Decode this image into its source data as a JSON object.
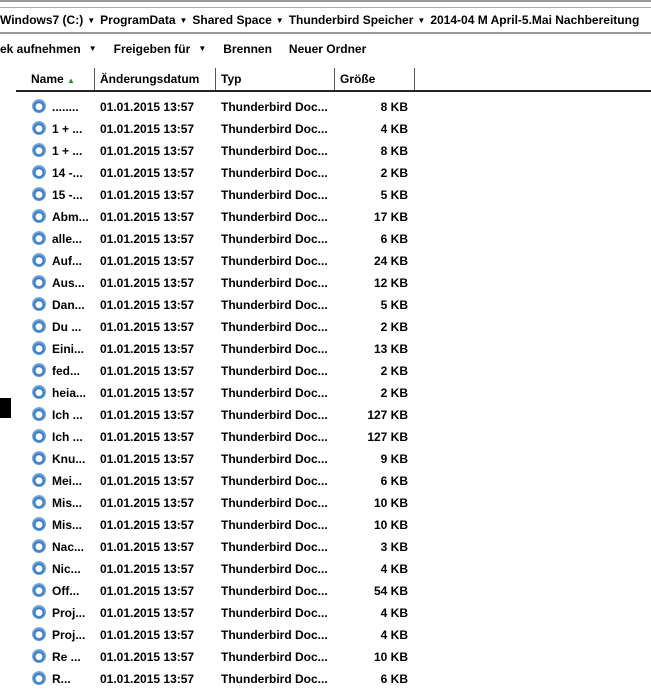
{
  "breadcrumb": [
    "Windows7 (C:)",
    "ProgramData",
    "Shared Space",
    "Thunderbird Speicher",
    "2014-04 M April-5.Mai Nachbereitung"
  ],
  "toolbar": [
    {
      "label": "ek aufnehmen",
      "dropdown": true
    },
    {
      "label": "Freigeben für",
      "dropdown": true
    },
    {
      "label": "Brennen",
      "dropdown": false
    },
    {
      "label": "Neuer Ordner",
      "dropdown": false
    }
  ],
  "columns": {
    "name": "Name",
    "sort_icon": "▲",
    "date": "Änderungsdatum",
    "type": "Typ",
    "size": "Größe"
  },
  "files": [
    {
      "name": "........",
      "date": "01.01.2015 13:57",
      "type": "Thunderbird Doc...",
      "size": "8 KB"
    },
    {
      "name": "1 + ...",
      "date": "01.01.2015 13:57",
      "type": "Thunderbird Doc...",
      "size": "4 KB"
    },
    {
      "name": "1 + ...",
      "date": "01.01.2015 13:57",
      "type": "Thunderbird Doc...",
      "size": "8 KB"
    },
    {
      "name": "14 -...",
      "date": "01.01.2015 13:57",
      "type": "Thunderbird Doc...",
      "size": "2 KB"
    },
    {
      "name": "15 -...",
      "date": "01.01.2015 13:57",
      "type": "Thunderbird Doc...",
      "size": "5 KB"
    },
    {
      "name": "Abm...",
      "date": "01.01.2015 13:57",
      "type": "Thunderbird Doc...",
      "size": "17 KB"
    },
    {
      "name": "alle...",
      "date": "01.01.2015 13:57",
      "type": "Thunderbird Doc...",
      "size": "6 KB"
    },
    {
      "name": "Auf...",
      "date": "01.01.2015 13:57",
      "type": "Thunderbird Doc...",
      "size": "24 KB"
    },
    {
      "name": "Aus...",
      "date": "01.01.2015 13:57",
      "type": "Thunderbird Doc...",
      "size": "12 KB"
    },
    {
      "name": "Dan...",
      "date": "01.01.2015 13:57",
      "type": "Thunderbird Doc...",
      "size": "5 KB"
    },
    {
      "name": "Du ...",
      "date": "01.01.2015 13:57",
      "type": "Thunderbird Doc...",
      "size": "2 KB"
    },
    {
      "name": "Eini...",
      "date": "01.01.2015 13:57",
      "type": "Thunderbird Doc...",
      "size": "13 KB"
    },
    {
      "name": "fed...",
      "date": "01.01.2015 13:57",
      "type": "Thunderbird Doc...",
      "size": "2 KB"
    },
    {
      "name": "heia...",
      "date": "01.01.2015 13:57",
      "type": "Thunderbird Doc...",
      "size": "2 KB"
    },
    {
      "name": "Ich ...",
      "date": "01.01.2015 13:57",
      "type": "Thunderbird Doc...",
      "size": "127 KB"
    },
    {
      "name": "Ich ...",
      "date": "01.01.2015 13:57",
      "type": "Thunderbird Doc...",
      "size": "127 KB"
    },
    {
      "name": "Knu...",
      "date": "01.01.2015 13:57",
      "type": "Thunderbird Doc...",
      "size": "9 KB"
    },
    {
      "name": "Mei...",
      "date": "01.01.2015 13:57",
      "type": "Thunderbird Doc...",
      "size": "6 KB"
    },
    {
      "name": "Mis...",
      "date": "01.01.2015 13:57",
      "type": "Thunderbird Doc...",
      "size": "10 KB"
    },
    {
      "name": "Mis...",
      "date": "01.01.2015 13:57",
      "type": "Thunderbird Doc...",
      "size": "10 KB"
    },
    {
      "name": "Nac...",
      "date": "01.01.2015 13:57",
      "type": "Thunderbird Doc...",
      "size": "3 KB"
    },
    {
      "name": "Nic...",
      "date": "01.01.2015 13:57",
      "type": "Thunderbird Doc...",
      "size": "4 KB"
    },
    {
      "name": "Off...",
      "date": "01.01.2015 13:57",
      "type": "Thunderbird Doc...",
      "size": "54 KB"
    },
    {
      "name": "Proj...",
      "date": "01.01.2015 13:57",
      "type": "Thunderbird Doc...",
      "size": "4 KB"
    },
    {
      "name": "Proj...",
      "date": "01.01.2015 13:57",
      "type": "Thunderbird Doc...",
      "size": "4 KB"
    },
    {
      "name": "Re ...",
      "date": "01.01.2015 13:57",
      "type": "Thunderbird Doc...",
      "size": "10 KB"
    },
    {
      "name": "R...",
      "date": "01.01.2015 13:57",
      "type": "Thunderbird Doc...",
      "size": "6 KB"
    }
  ]
}
